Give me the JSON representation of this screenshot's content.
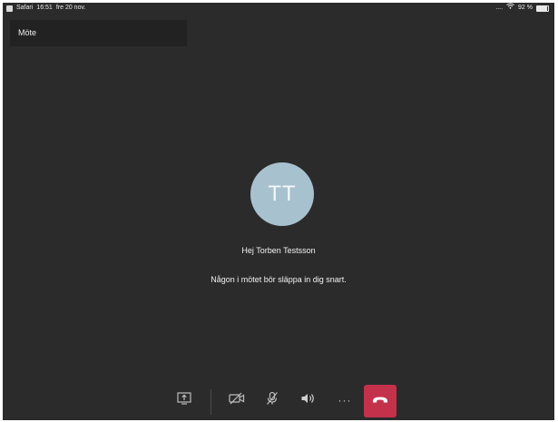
{
  "status_bar": {
    "app": "Safari",
    "time": "16:51",
    "date": "fre 20 nov.",
    "signal": "....",
    "battery_text": "92 %",
    "battery_level": 0.92
  },
  "header": {
    "title": "Möte"
  },
  "lobby": {
    "avatar_initials": "TT",
    "greeting": "Hej Torben Testsson",
    "message": "Någon i mötet bör släppa in dig snart."
  },
  "toolbar": {
    "buttons": [
      "share-tray-icon",
      "video-off-icon",
      "mic-off-icon",
      "speaker-icon",
      "more-icon",
      "hang-up-icon"
    ],
    "more_label": "···"
  },
  "colors": {
    "background": "#2b2b2b",
    "avatar": "#a8c1cf",
    "hangup": "#c4314b",
    "title_box": "#222222"
  }
}
